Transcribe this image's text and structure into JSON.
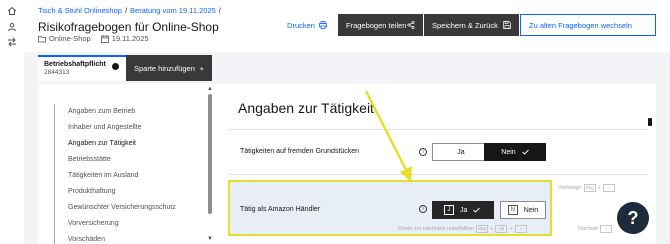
{
  "rail": {
    "icons": [
      "home-icon",
      "user-icon",
      "swap-icon"
    ]
  },
  "header": {
    "breadcrumb": [
      "Tisch & Stuhl Onlineshop",
      "Beratung vom 19.11.2025"
    ],
    "breadcrumb_sep": "/",
    "title": "Risikofragebogen für Online-Shop",
    "meta_shop": "Online-Shop",
    "meta_date": "19.11.2025",
    "actions": {
      "print": "Drucken",
      "share": "Fragebogen teilen",
      "save_back": "Speichern & Zurück",
      "old_switch": "Zu alten Fragebogen wechseln"
    }
  },
  "tabs": {
    "active_title": "Betriebshaftpflicht",
    "active_sub": "2844313",
    "add_label": "Sparte hinzufügen",
    "add_icon": "+"
  },
  "nav": {
    "items": [
      "Angaben zum Betrieb",
      "Inhaber und Angestellte",
      "Angaben zur Tätigkeit",
      "Betriebsstätte",
      "Tätigkeiten im Ausland",
      "Produkthaftung",
      "Gewünschter Versicherungsschutz",
      "Vorversicherung",
      "Vorschäden"
    ],
    "active_index": 2
  },
  "section": {
    "title": "Angaben zur Tätigkeit",
    "q1": {
      "label": "Tätigkeiten auf fremden Grundstücken",
      "yes": "Ja",
      "no": "Nein"
    },
    "q2": {
      "label": "Tätig als Amazon Händler",
      "yes": "Ja",
      "no": "Nein",
      "key_yes": "J",
      "key_no": "N"
    },
    "hint_prev": "Vorherige",
    "hint_prev_key1": "Strg",
    "hint_prev_key2": "↑",
    "hint_next_direct": "Direkt zur nächsten unbefüllten",
    "hint_next_key1": "Strg",
    "hint_next_key2": "Alt",
    "hint_next_key3": "↓",
    "hint_next": "Nächste",
    "hint_next_key": "↓",
    "info_glyph": "i"
  },
  "help": "?",
  "colors": {
    "accent": "#0f62fe",
    "dark": "#393939",
    "highlight_border": "#e5e02b",
    "help_bg": "#1d2b3a"
  }
}
